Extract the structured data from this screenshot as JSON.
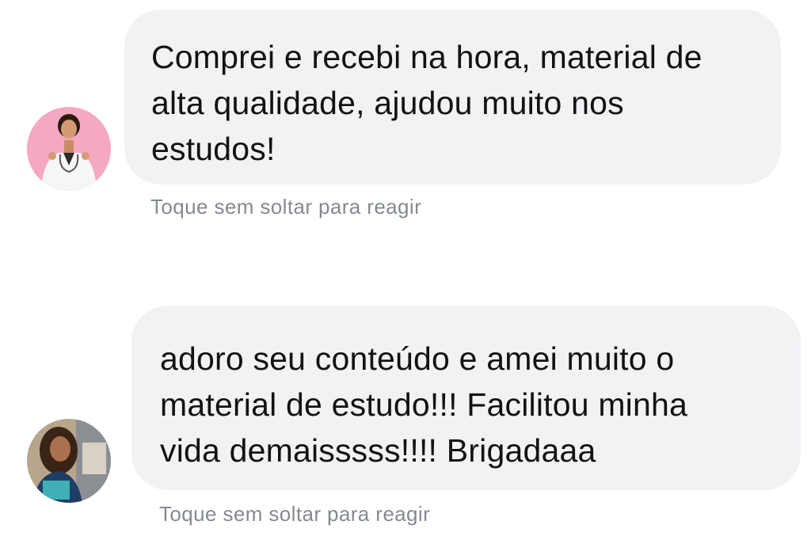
{
  "messages": [
    {
      "avatar_icon": "avatar-doctor-pink-background",
      "text": "Comprei e recebi na hora, material de\nalta qualidade, ajudou muito nos\nestudos!",
      "reaction_hint": "Toque sem soltar para reagir"
    },
    {
      "avatar_icon": "avatar-student-with-notebook",
      "text": "adoro seu conteúdo e amei muito o\nmaterial de estudo!!! Facilitou minha\nvida demaisssss!!!! Brigadaaa",
      "reaction_hint": "Toque sem soltar para reagir"
    }
  ],
  "colors": {
    "bubble_background": "#f1f2f4",
    "message_text": "#121212",
    "hint_text": "#858a91",
    "avatar1_background": "#f4a9c0"
  }
}
